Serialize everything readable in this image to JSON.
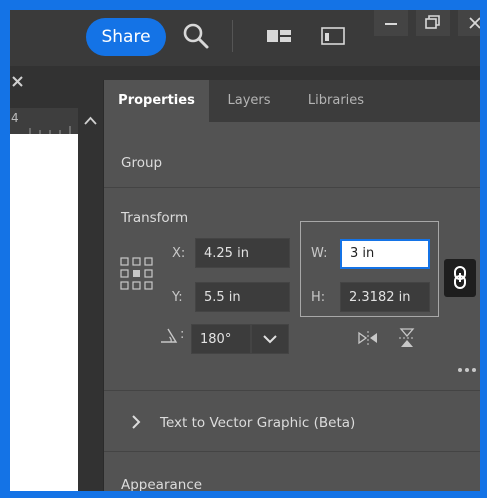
{
  "titlebar": {
    "share_label": "Share"
  },
  "document": {
    "ruler_number": "4"
  },
  "panel": {
    "tabs": [
      {
        "label": "Properties",
        "active": true
      },
      {
        "label": "Layers",
        "active": false
      },
      {
        "label": "Libraries",
        "active": false
      }
    ],
    "group_label": "Group",
    "transform": {
      "title": "Transform",
      "x_label": "X:",
      "x_value": "4.25 in",
      "y_label": "Y:",
      "y_value": "5.5 in",
      "w_label": "W:",
      "w_value": "3 in",
      "h_label": "H:",
      "h_value": "2.3182 in",
      "angle_label": ":",
      "angle_value": "180°"
    },
    "text_to_vector": "Text to Vector Graphic (Beta)",
    "appearance": "Appearance"
  },
  "colors": {
    "accent": "#1473e6",
    "panel_bg": "#535353",
    "tab_bar_bg": "#3c3c3c",
    "field_bg": "#3c3c3c"
  }
}
